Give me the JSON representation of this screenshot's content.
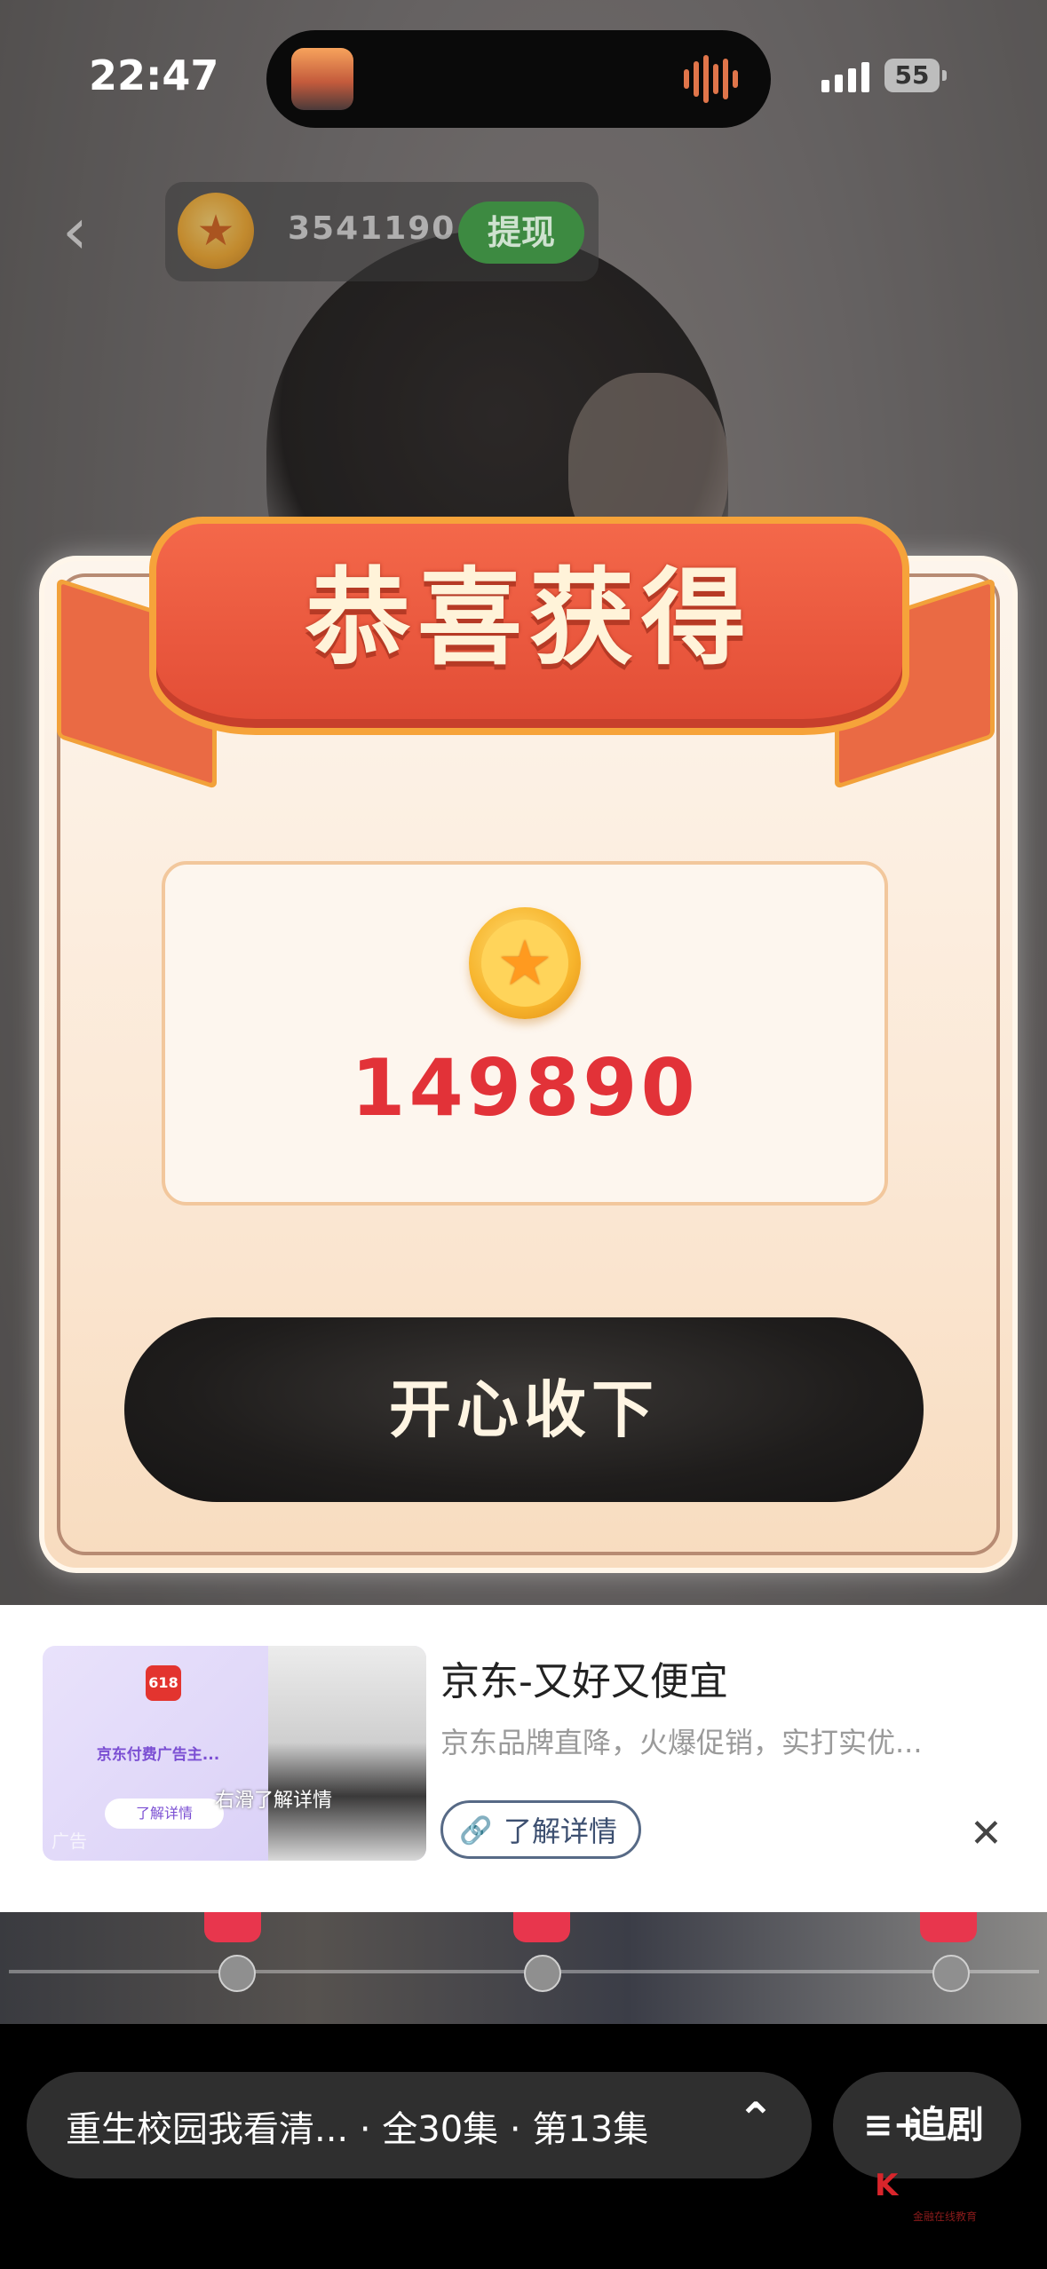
{
  "status_bar": {
    "time": "22:47",
    "battery": "55"
  },
  "top_bar": {
    "coin_balance": "3541190",
    "withdraw_label": "提现"
  },
  "reward_modal": {
    "title": "恭喜获得",
    "amount": "149890",
    "accept_label": "开心收下"
  },
  "ad": {
    "title": "京东-又好又便宜",
    "description": "京东品牌直降，火爆促销，实打实优...",
    "link_label": "了解详情",
    "thumb_logo": "618",
    "thumb_text": "京东付费广告主...",
    "thumb_button": "了解详情",
    "thumb_swipe": "右滑了解详情",
    "thumb_badge": "广告",
    "close_icon": "close-icon"
  },
  "player": {
    "episode_text": "重生校园我看清... · 全30集 · 第13集",
    "follow_label": "追剧"
  },
  "watermark": {
    "mark": "K",
    "text": "金融在线教育"
  },
  "colors": {
    "accent_red": "#e23238",
    "withdraw_green": "#3d8a41",
    "ribbon": "#e24c35"
  }
}
